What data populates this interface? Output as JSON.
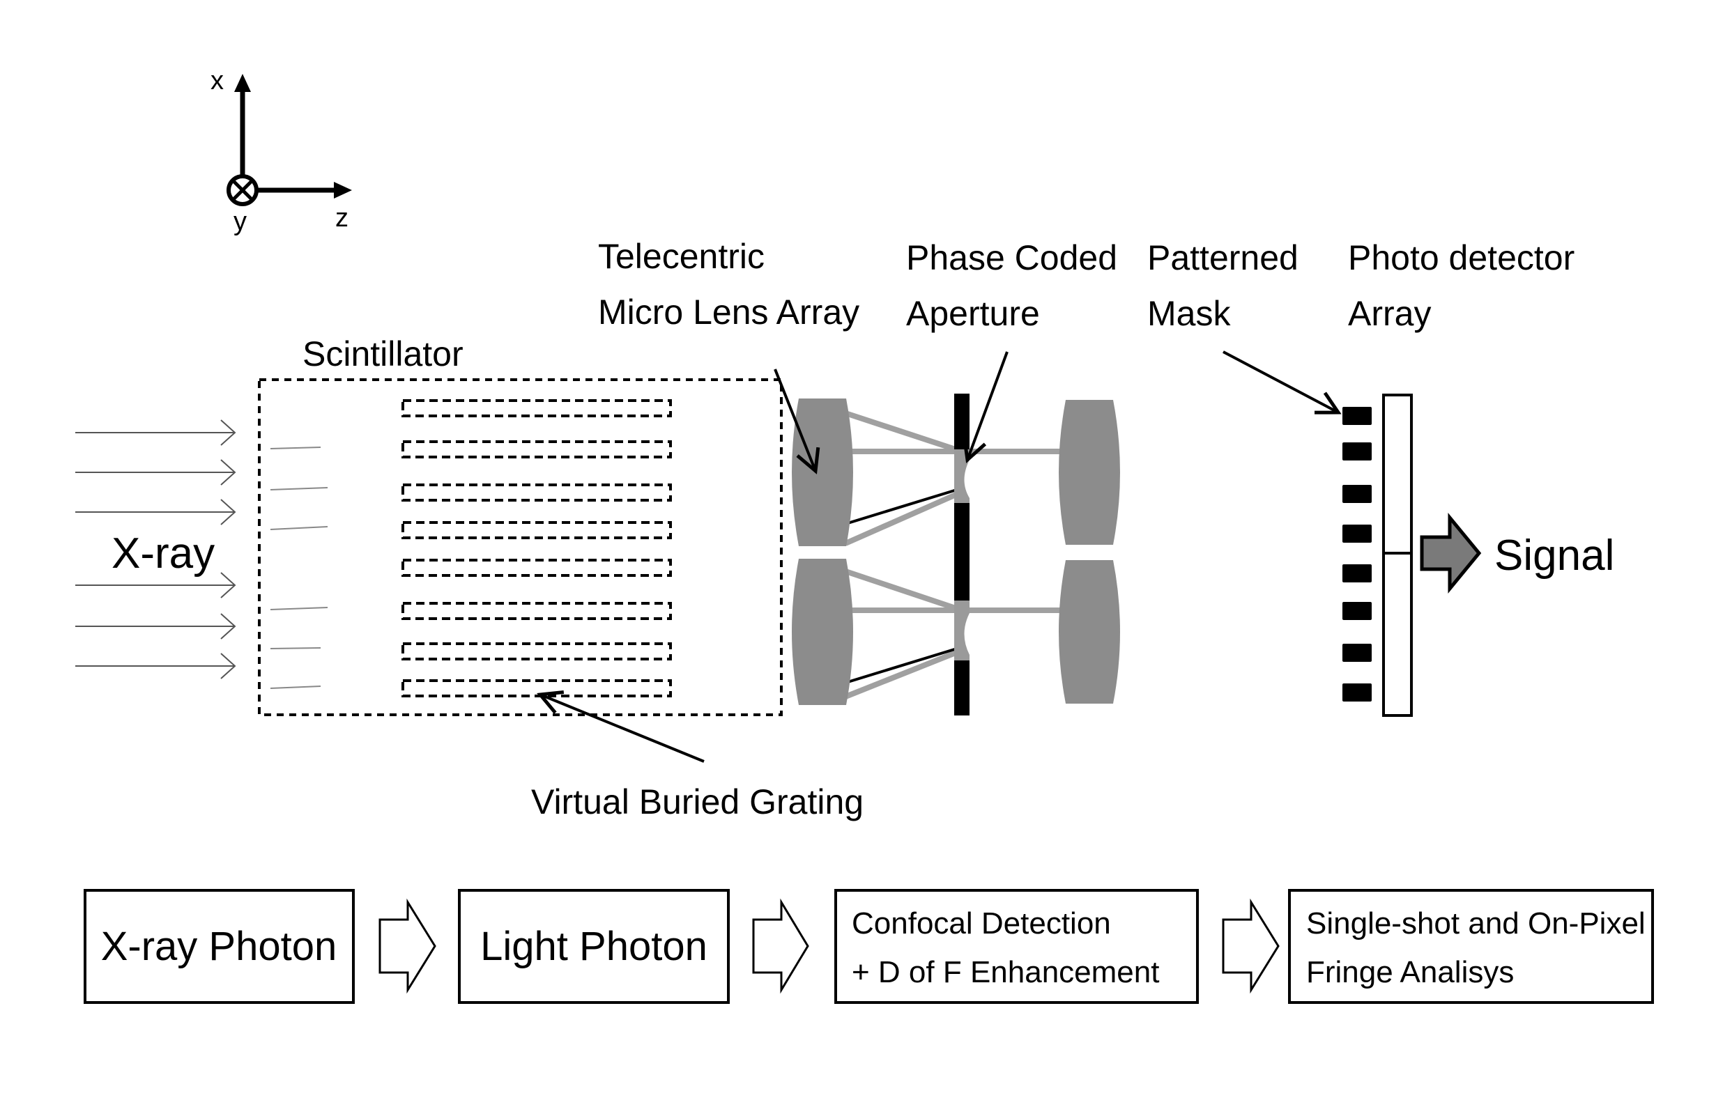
{
  "axes": {
    "x_label": "x",
    "y_label": "y",
    "z_label": "z"
  },
  "labels": {
    "scintillator": "Scintillator",
    "xray": "X-ray",
    "lens_array_line1": "Telecentric",
    "lens_array_line2": "Micro Lens Array",
    "aperture_line1": "Phase Coded",
    "aperture_line2": "Aperture",
    "mask_line1": "Patterned",
    "mask_line2": "Mask",
    "detector_line1": "Photo detector",
    "detector_line2": "Array",
    "signal": "Signal",
    "grating": "Virtual Buried Grating"
  },
  "flow": {
    "steps": [
      {
        "lines": [
          "X-ray Photon"
        ]
      },
      {
        "lines": [
          "Light Photon"
        ]
      },
      {
        "lines": [
          "Confocal Detection",
          "+ D of F Enhancement"
        ]
      },
      {
        "lines": [
          "Single-shot and On-Pixel",
          "Fringe Analisys"
        ]
      }
    ]
  },
  "components": {
    "xray_beam_count": 6,
    "grating_line_count": 8,
    "lens_pairs": 2,
    "mask_element_count": 8,
    "detector_pixel_count": 2
  },
  "colors": {
    "ink": "#000000",
    "lens_fill": "#8c8c8c",
    "beam_gray": "#9a9a9a",
    "signal_arrow_fill": "#7a7a7a"
  }
}
